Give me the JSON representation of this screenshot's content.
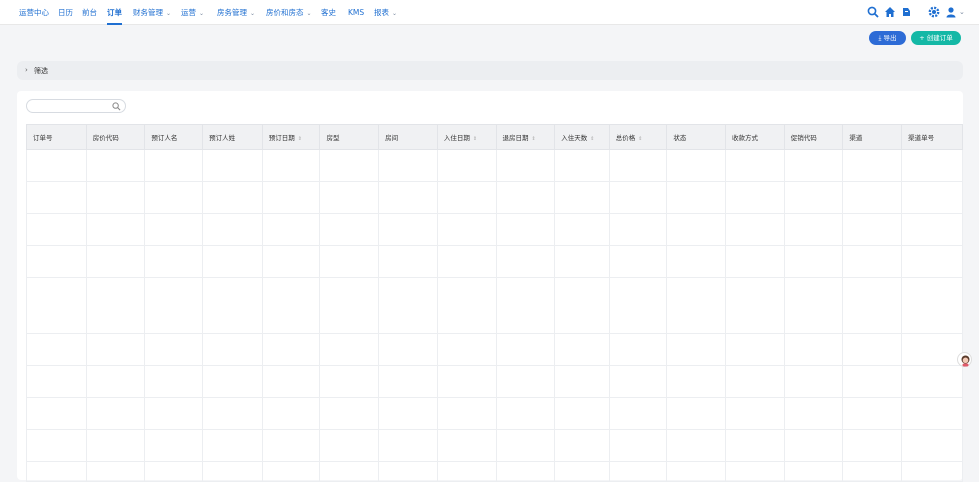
{
  "nav": {
    "items": [
      {
        "label": "运营中心",
        "dropdown": false,
        "active": false
      },
      {
        "label": "日历",
        "dropdown": false,
        "active": false
      },
      {
        "label": "前台",
        "dropdown": false,
        "active": false
      },
      {
        "label": "订单",
        "dropdown": false,
        "active": true
      },
      {
        "label": "财务管理",
        "dropdown": true,
        "active": false
      },
      {
        "label": "运营",
        "dropdown": true,
        "active": false
      },
      {
        "label": "房务管理",
        "dropdown": true,
        "active": false
      },
      {
        "label": "房价和房态",
        "dropdown": true,
        "active": false
      },
      {
        "label": "客史",
        "dropdown": false,
        "active": false
      },
      {
        "label": "KMS",
        "dropdown": false,
        "active": false
      },
      {
        "label": "报表",
        "dropdown": true,
        "active": false
      }
    ],
    "icons": [
      "search-icon",
      "home-icon",
      "notification-icon",
      "settings-icon",
      "user-icon"
    ]
  },
  "actions": {
    "export_label": "⤓ 导出",
    "create_label": "+ 创建订单"
  },
  "filter": {
    "label": "筛选"
  },
  "search": {
    "placeholder": ""
  },
  "table": {
    "headers": [
      "订单号",
      "房价代码",
      "预订人名",
      "预订人姓",
      "预订日期",
      "房型",
      "房间",
      "入住日期",
      "退房日期",
      "入住天数",
      "总价格",
      "状态",
      "收款方式",
      "促销代码",
      "渠道",
      "渠道单号"
    ],
    "sortable": [
      false,
      false,
      false,
      false,
      true,
      false,
      false,
      true,
      true,
      true,
      true,
      false,
      false,
      false,
      false,
      false
    ],
    "row_heights": [
      32,
      32,
      32,
      32,
      56,
      32,
      32,
      32,
      32,
      20
    ]
  },
  "colors": {
    "brand": "#1f6fd1",
    "export_button": "#2d6bd6",
    "create_button": "#14b8a6",
    "header_bg": "#f0f1f3"
  }
}
